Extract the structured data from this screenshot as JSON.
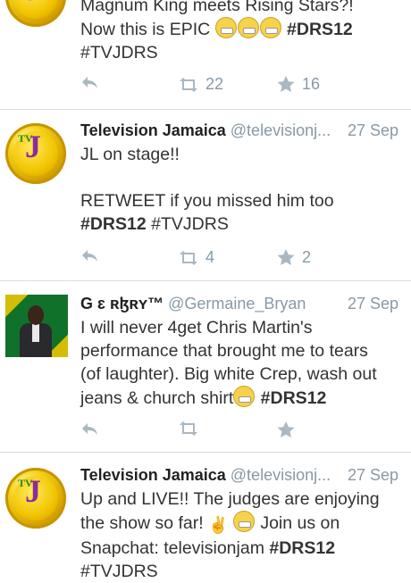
{
  "tweets": [
    {
      "partial_line": "Magnum King meets Rising Stars?!",
      "text_pre": "Now this is EPIC ",
      "tag1": "#DRS12",
      "tag2": "#TVJDRS",
      "retweets": "22",
      "favorites": "16"
    },
    {
      "name": "Television Jamaica",
      "handle": "@televisionj...",
      "date": "27 Sep",
      "line1": "JL on stage!!",
      "line2": "RETWEET if you missed him too",
      "tag1": "#DRS12",
      "tag2": "#TVJDRS",
      "retweets": "4",
      "favorites": "2"
    },
    {
      "name": "G ɛ ʀɮʀʏ™",
      "handle": "@Germaine_Bryan",
      "date": "27 Sep",
      "line1": "I will never 4get Chris Martin's",
      "line2": "performance that brought me to tears",
      "line3": "(of laughter). Big white Crep, wash out",
      "line4_pre": "jeans & church shirt",
      "tag1": "#DRS12"
    },
    {
      "name": "Television Jamaica",
      "handle": "@televisionj...",
      "date": "27 Sep",
      "line1": "Up and LIVE!!  The judges are enjoying",
      "line2_pre": "the show so far! ",
      "line2_post": " Join us on",
      "line3_pre": "Snapchat: televisionjam ",
      "tag1": "#DRS12",
      "tag2": "#TVJDRS"
    }
  ],
  "icons": {
    "reply": "reply-icon",
    "retweet": "retweet-icon",
    "favorite": "star-icon"
  },
  "colors": {
    "text": "#333333",
    "meta": "#8899a6",
    "icon": "#aab8c2",
    "divider": "#dcdcdc"
  }
}
